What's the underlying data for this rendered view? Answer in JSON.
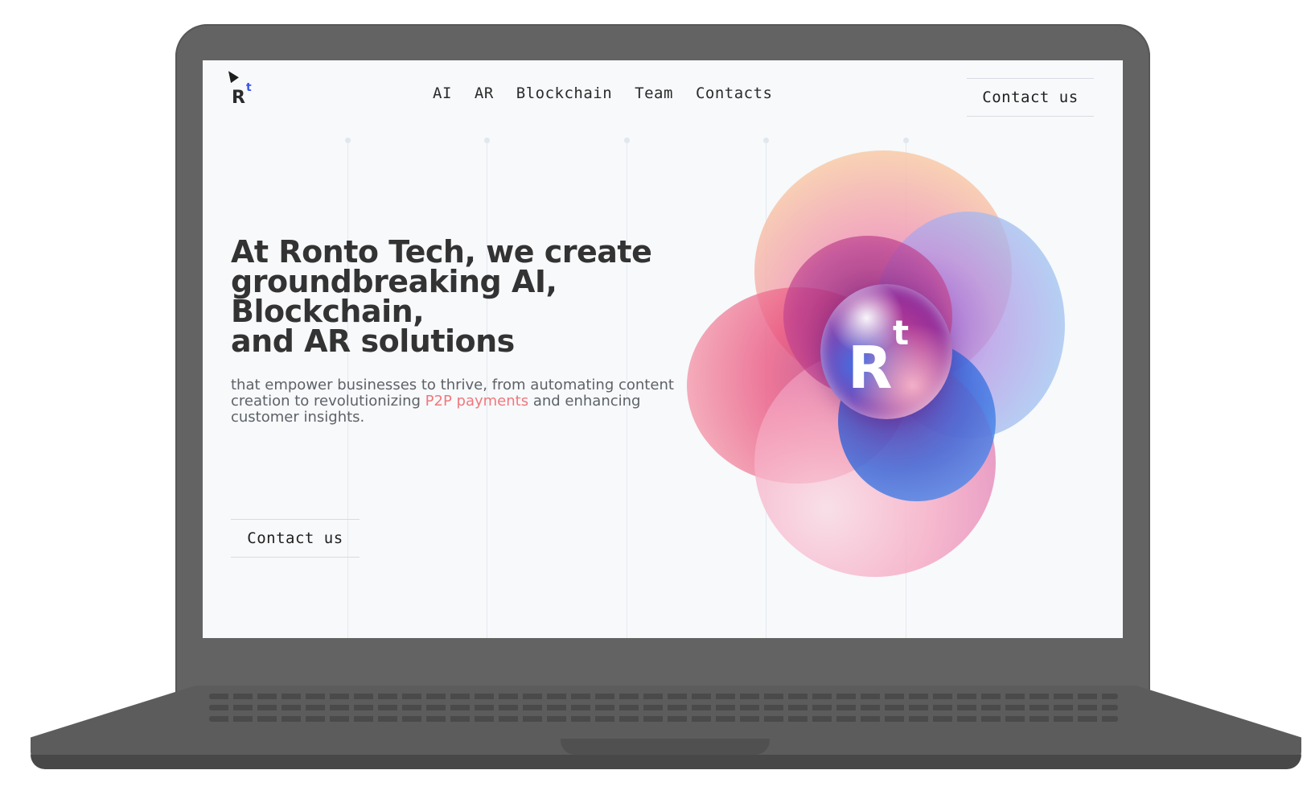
{
  "logo": {
    "letter": "R",
    "mark": "t"
  },
  "nav": {
    "links": [
      "AI",
      "AR",
      "Blockchain",
      "Team",
      "Contacts"
    ]
  },
  "header": {
    "cta_label": "Contact us"
  },
  "hero": {
    "title_lines": [
      "At Ronto Tech, we create",
      "groundbreaking AI,",
      "Blockchain,",
      "and AR solutions"
    ],
    "subtitle_before": "that empower businesses to thrive, from automating content creation to revolutionizing ",
    "subtitle_highlight": "P2P payments",
    "subtitle_after": " and enhancing customer insights.",
    "cta_label": "Contact us"
  },
  "orb": {
    "letter": "R",
    "mark": "t"
  },
  "colors": {
    "text": "#333333",
    "accent_highlight": "#f0787d",
    "logo_accent": "#3655e6",
    "background": "#f7f9fb"
  }
}
